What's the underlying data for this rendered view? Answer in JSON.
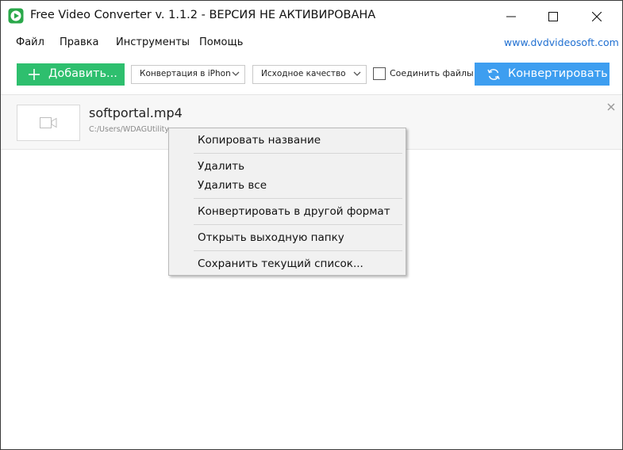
{
  "window": {
    "title": "Free Video Converter v. 1.1.2 - ВЕРСИЯ НЕ АКТИВИРОВАНА",
    "app_icon": "play-icon",
    "controls": [
      "minimize-icon",
      "maximize-icon",
      "close-icon"
    ]
  },
  "menu": {
    "file": "Файл",
    "edit": "Правка",
    "tools": "Инструменты",
    "help": "Помощь",
    "site": "www.dvdvideosoft.com"
  },
  "toolbar": {
    "add_label": "Добавить...",
    "format_value": "Конвертация в iPhon",
    "quality_value": "Исходное качество",
    "merge_label": "Соединить файлы",
    "merge_checked": false,
    "convert_label": "Конвертировать"
  },
  "files": [
    {
      "name": "softportal.mp4",
      "path": "C:/Users/WDAGUtility..."
    }
  ],
  "context_menu": {
    "copy_name": "Копировать название",
    "delete": "Удалить",
    "delete_all": "Удалить все",
    "convert_other": "Конвертировать в другой формат",
    "open_output": "Открыть выходную папку",
    "save_list": "Сохранить текущий список..."
  },
  "colors": {
    "add_button": "#2ebf6e",
    "convert_button": "#3d9ef0",
    "link": "#1f6fd1"
  }
}
